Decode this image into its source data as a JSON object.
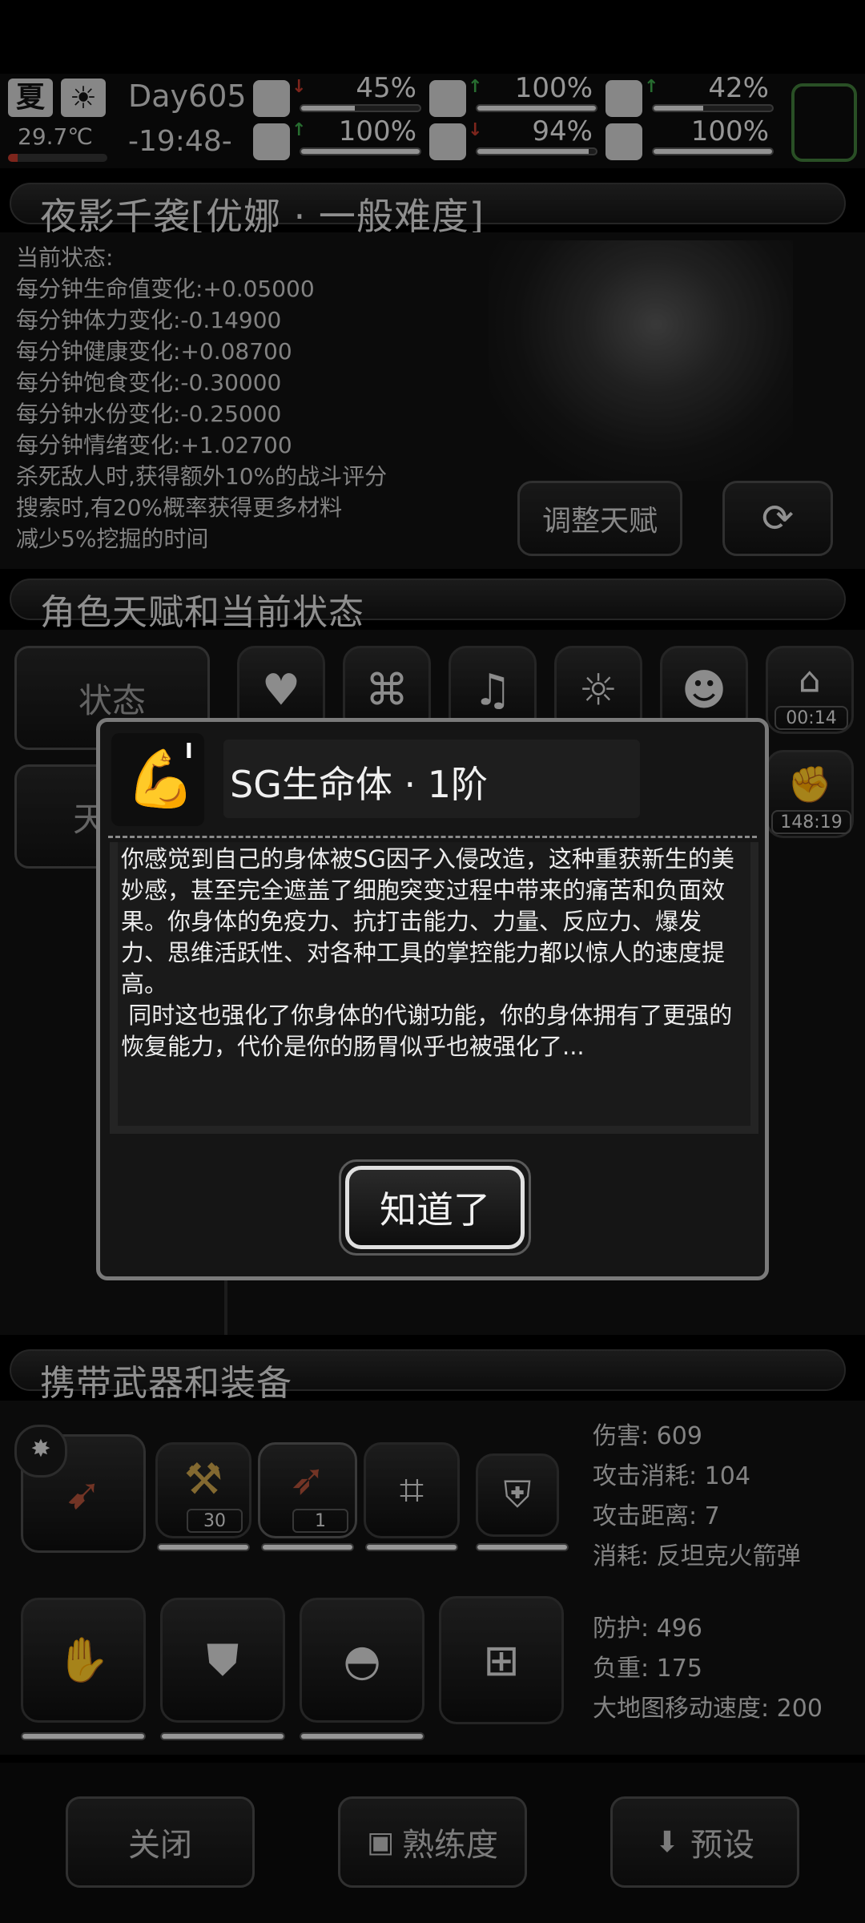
{
  "status_bar": {
    "season": "夏",
    "temperature": "29.7℃",
    "day": "Day605",
    "time": "-19:48-",
    "stats": [
      {
        "icon": "medkit-icon",
        "trend": "down",
        "value": "45%",
        "fill": 0.45
      },
      {
        "icon": "stomach-icon",
        "trend": "up",
        "value": "100%",
        "fill": 1.0
      },
      {
        "icon": "helmet-icon",
        "trend": "up",
        "value": "42%",
        "fill": 0.42
      },
      {
        "icon": "boot-icon",
        "trend": "up",
        "value": "100%",
        "fill": 1.0
      },
      {
        "icon": "water-drop-icon",
        "trend": "down",
        "value": "94%",
        "fill": 0.94
      },
      {
        "icon": "heart-icon",
        "trend": "none",
        "value": "100%",
        "fill": 1.0
      }
    ]
  },
  "character": {
    "title": "夜影千袭[优娜 · 一般难度]",
    "state_lines": [
      "当前状态:",
      "每分钟生命值变化:+0.05000",
      "每分钟体力变化:-0.14900",
      "每分钟健康变化:+0.08700",
      "每分钟饱食变化:-0.30000",
      "每分钟水份变化:-0.25000",
      "每分钟情绪变化:+1.02700",
      "杀死敌人时,获得额外10%的战斗评分",
      "搜索时,有20%概率获得更多材料",
      "减少5%挖掘的时间"
    ],
    "adjust_talent_label": "调整天赋"
  },
  "talent_section": {
    "title": "角色天赋和当前状态",
    "tab_state": "状态",
    "tab_talent": "天",
    "timer1": "00:14",
    "timer2": "148:19"
  },
  "dialog": {
    "title": "SG生命体 · 1阶",
    "tier_mark": "I",
    "paragraph1": "你感觉到自己的身体被SG因子入侵改造，这种重获新生的美妙感，甚至完全遮盖了细胞突变过程中带来的痛苦和负面效果。你身体的免疫力、抗打击能力、力量、反应力、爆发力、思维活跃性、对各种工具的掌控能力都以惊人的速度提高。",
    "paragraph2": " 同时这也强化了你身体的代谢功能，你的身体拥有了更强的恢复能力，代价是你的肠胃似乎也被强化了...",
    "confirm_label": "知道了"
  },
  "equipment": {
    "title": "携带武器和装备",
    "weapon_stats": [
      "伤害: 609",
      "攻击消耗: 104",
      "攻击距离: 7",
      "消耗: 反坦克火箭弹"
    ],
    "armor_stats": [
      "防护: 496",
      "负重: 175",
      "大地图移动速度: 200"
    ],
    "ammo_count_1": "30",
    "ammo_count_2": "1"
  },
  "footer": {
    "close_label": "关闭",
    "proficiency_label": "熟练度",
    "preset_label": "预设"
  }
}
